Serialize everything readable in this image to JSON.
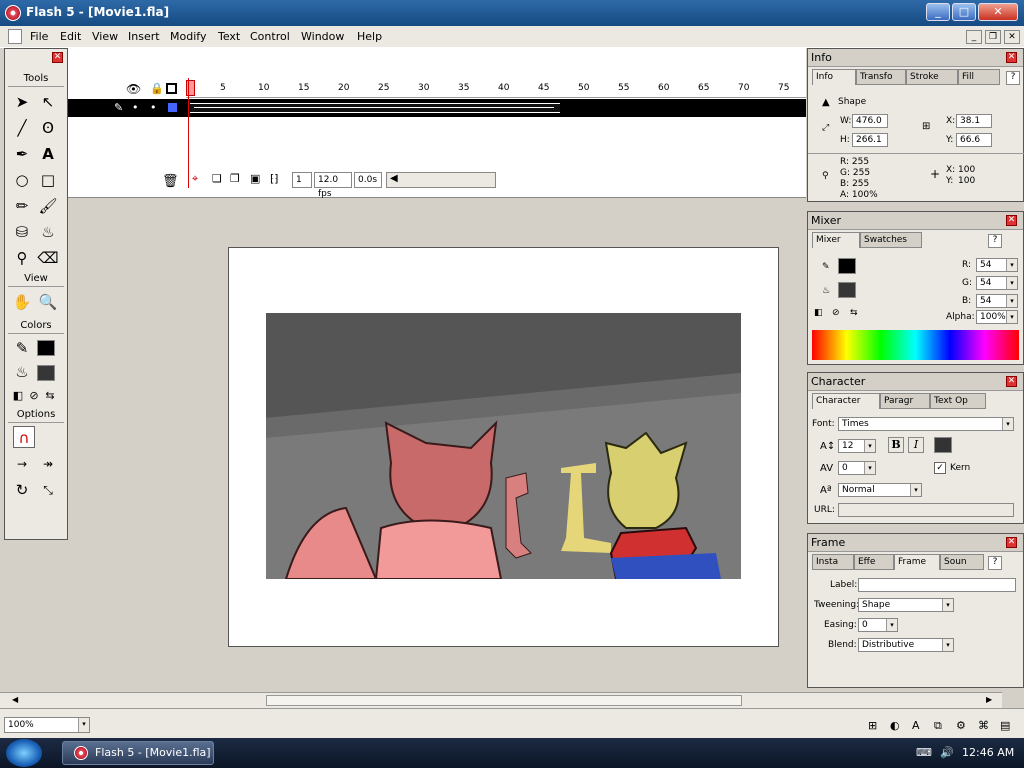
{
  "window": {
    "title": "Flash 5 - [Movie1.fla]",
    "min": "_",
    "max": "□",
    "close": "✕"
  },
  "menu": [
    "File",
    "Edit",
    "View",
    "Insert",
    "Modify",
    "Text",
    "Control",
    "Window",
    "Help"
  ],
  "timeline": {
    "frames": [
      "1",
      "5",
      "10",
      "15",
      "20",
      "25",
      "30",
      "35",
      "40",
      "45",
      "50",
      "55",
      "60",
      "65",
      "70",
      "75"
    ],
    "frame": "1",
    "fps": "12.0 fps",
    "time": "0.0s"
  },
  "tools": {
    "title": "Tools",
    "view": "View",
    "colors": "Colors",
    "options": "Options"
  },
  "info": {
    "title": "Info",
    "tabs": [
      "Info",
      "Transfo",
      "Stroke",
      "Fill"
    ],
    "shape": "Shape",
    "w_label": "W:",
    "w": "476.0",
    "h_label": "H:",
    "h": "266.1",
    "x_label": "X:",
    "x": "38.1",
    "y_label": "Y:",
    "y": "66.6",
    "r": "R: 255",
    "g": "G: 255",
    "b": "B: 255",
    "a": "A: 100%",
    "cx_label": "X:",
    "cx": "100",
    "cy_label": "Y:",
    "cy": "100"
  },
  "mixer": {
    "title": "Mixer",
    "tabs": [
      "Mixer",
      "Swatches"
    ],
    "r_label": "R:",
    "r": "54",
    "g_label": "G:",
    "g": "54",
    "b_label": "B:",
    "b": "54",
    "alpha_label": "Alpha:",
    "alpha": "100%"
  },
  "character": {
    "title": "Character",
    "tabs": [
      "Character",
      "Paragr",
      "Text Op"
    ],
    "font_label": "Font:",
    "font": "Times",
    "size": "12",
    "tracking": "0",
    "kern": "Kern",
    "baseline": "Normal",
    "url_label": "URL:",
    "bold": "B",
    "italic": "I"
  },
  "frame_panel": {
    "title": "Frame",
    "tabs": [
      "Insta",
      "Effe",
      "Frame",
      "Soun"
    ],
    "label_label": "Label:",
    "tweening_label": "Tweening:",
    "tweening": "Shape",
    "easing_label": "Easing:",
    "easing": "0",
    "blend_label": "Blend:",
    "blend": "Distributive"
  },
  "status": {
    "zoom": "100%"
  },
  "taskbar": {
    "app": "Flash 5 - [Movie1.fla]",
    "clock": "12:46 AM"
  },
  "colors": {
    "stroke": "#000000",
    "fill": "#363636"
  }
}
